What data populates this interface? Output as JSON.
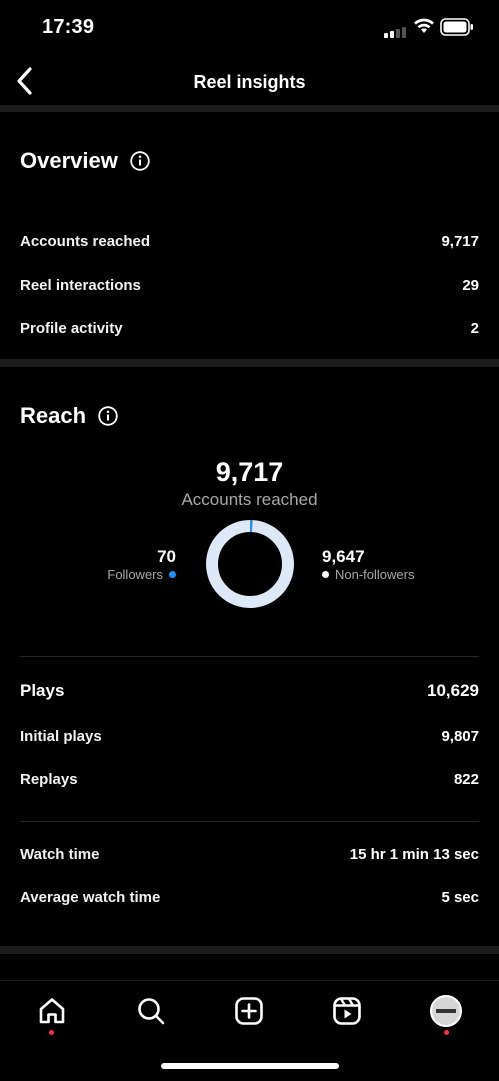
{
  "status": {
    "time": "17:39"
  },
  "header": {
    "title": "Reel insights"
  },
  "overview": {
    "title": "Overview",
    "rows": [
      {
        "label": "Accounts reached",
        "value": "9,717"
      },
      {
        "label": "Reel interactions",
        "value": "29"
      },
      {
        "label": "Profile activity",
        "value": "2"
      }
    ]
  },
  "reach": {
    "title": "Reach",
    "total": "9,717",
    "total_label": "Accounts reached",
    "followers": {
      "value": "70",
      "label": "Followers",
      "color": "#1f8fff",
      "fraction": 0.0072
    },
    "non_followers": {
      "value": "9,647",
      "label": "Non-followers",
      "color": "#dde9f8"
    }
  },
  "plays": {
    "title": "Plays",
    "value": "10,629",
    "rows": [
      {
        "label": "Initial plays",
        "value": "9,807"
      },
      {
        "label": "Replays",
        "value": "822"
      }
    ]
  },
  "watch": {
    "rows": [
      {
        "label": "Watch time",
        "value": "15 hr 1 min 13 sec"
      },
      {
        "label": "Average watch time",
        "value": "5 sec"
      }
    ]
  },
  "tabbar": {
    "items": [
      "home-icon",
      "search-icon",
      "create-icon",
      "reels-icon",
      "profile-avatar"
    ]
  }
}
